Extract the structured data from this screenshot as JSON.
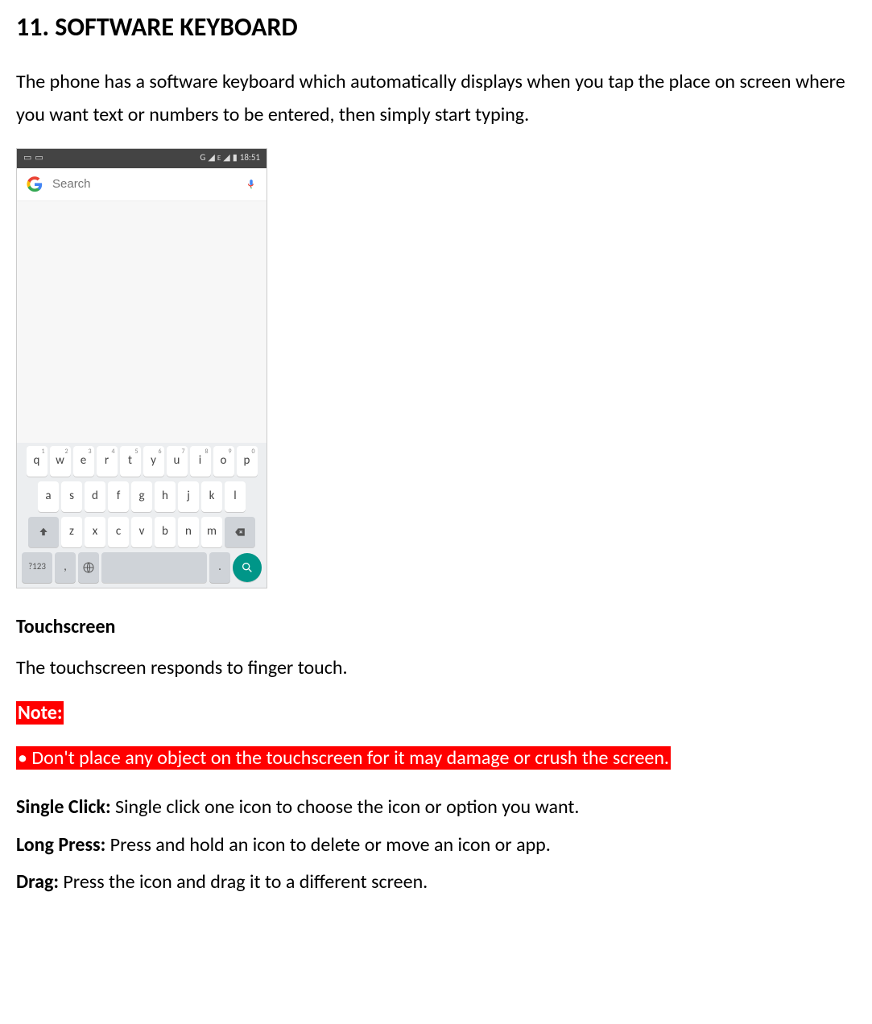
{
  "heading": "11. SOFTWARE KEYBOARD",
  "intro": "The phone has a software keyboard which automatically displays when you tap the place on screen where you want text or numbers to be entered, then simply start typing.",
  "phone": {
    "status": {
      "net_label": "G",
      "time": "18:51"
    },
    "search": {
      "placeholder": "Search"
    },
    "keyboard": {
      "row1": [
        {
          "k": "q",
          "n": "1"
        },
        {
          "k": "w",
          "n": "2"
        },
        {
          "k": "e",
          "n": "3"
        },
        {
          "k": "r",
          "n": "4"
        },
        {
          "k": "t",
          "n": "5"
        },
        {
          "k": "y",
          "n": "6"
        },
        {
          "k": "u",
          "n": "7"
        },
        {
          "k": "i",
          "n": "8"
        },
        {
          "k": "o",
          "n": "9"
        },
        {
          "k": "p",
          "n": "0"
        }
      ],
      "row2": [
        "a",
        "s",
        "d",
        "f",
        "g",
        "h",
        "j",
        "k",
        "l"
      ],
      "row3": [
        "z",
        "x",
        "c",
        "v",
        "b",
        "n",
        "m"
      ],
      "num_key": "?123",
      "comma": ",",
      "period": "."
    }
  },
  "touchscreen": {
    "heading": "Touchscreen",
    "text": "The touchscreen responds to finger touch."
  },
  "note": {
    "label": "Note:",
    "body": "• Don't place any object on the touchscreen for it may damage or crush the screen."
  },
  "actions": [
    {
      "label": "Single Click:",
      "text": " Single click one icon to choose the icon or option you want."
    },
    {
      "label": "Long Press:",
      "text": " Press and hold an icon to delete or move an icon or app."
    },
    {
      "label": "Drag:",
      "text": " Press the icon and drag it to a different screen."
    }
  ]
}
